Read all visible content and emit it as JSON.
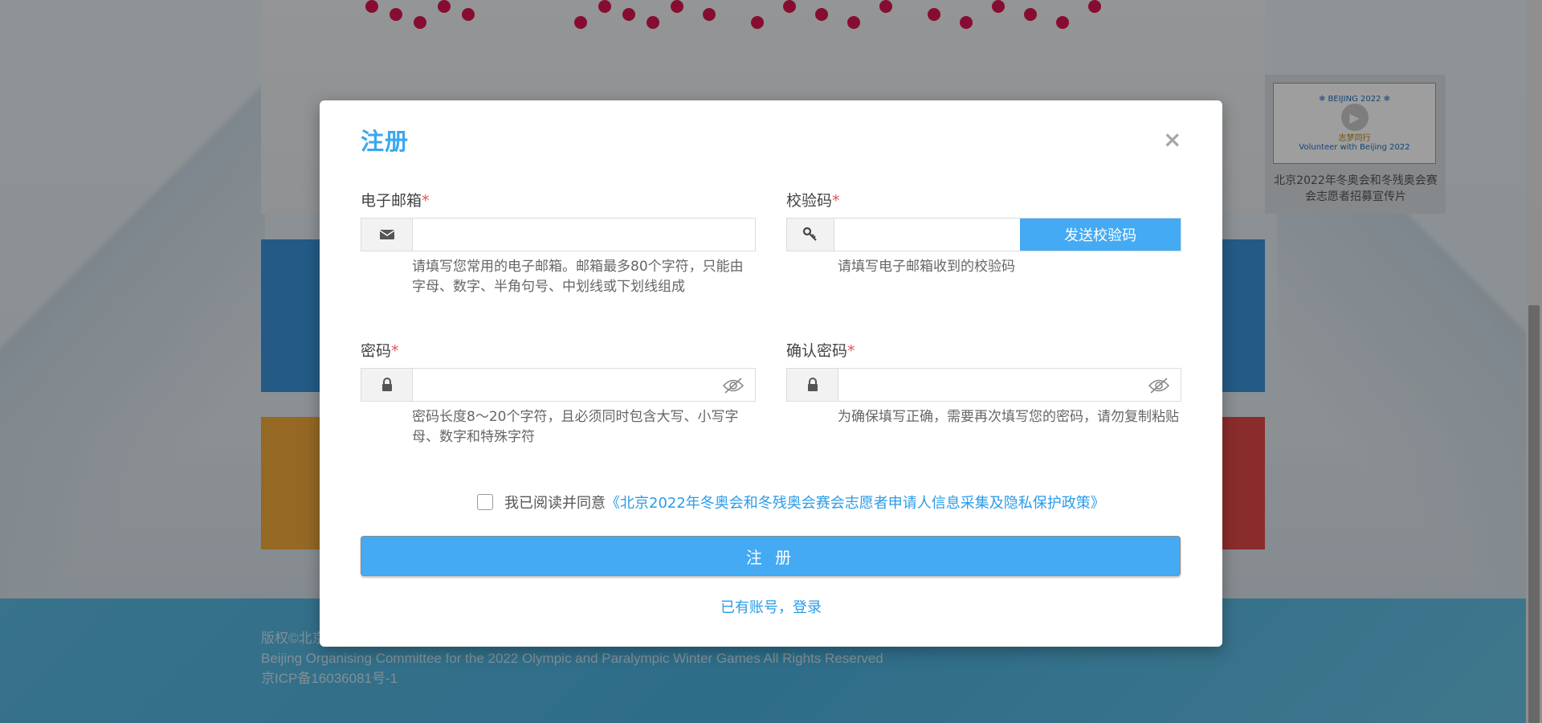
{
  "background": {
    "video_caption": "北京2022年冬奥会和冬残奥会赛会志愿者招募宣传片",
    "video_thumb_caption": "志梦同行",
    "video_thumb_sub": "Volunteer with Beijing 2022",
    "footer": {
      "copyright": "版权©北京",
      "org": "Beijing Organising Committee for the 2022 Olympic and Paralympic Winter Games All Rights Reserved",
      "icp": "京ICP备16036081号-1"
    }
  },
  "modal": {
    "title": "注册",
    "close_icon": "×",
    "email": {
      "label": "电子邮箱",
      "required_mark": "*",
      "value": "",
      "icon": "envelope-icon",
      "help": "请填写您常用的电子邮箱。邮箱最多80个字符，只能由字母、数字、半角句号、中划线或下划线组成"
    },
    "code": {
      "label": "校验码",
      "required_mark": "*",
      "value": "",
      "icon": "key-icon",
      "send_label": "发送校验码",
      "help": "请填写电子邮箱收到的校验码"
    },
    "password": {
      "label": "密码",
      "required_mark": "*",
      "value": "",
      "icon": "lock-icon",
      "help": "密码长度8～20个字符，且必须同时包含大写、小写字母、数字和特殊字符"
    },
    "confirm_password": {
      "label": "确认密码",
      "required_mark": "*",
      "value": "",
      "icon": "lock-icon",
      "help": "为确保填写正确，需要再次填写您的密码，请勿复制粘贴"
    },
    "agree": {
      "text": "我已阅读并同意",
      "policy_link": "《北京2022年冬奥会和冬残奥会赛会志愿者申请人信息采集及隐私保护政策》",
      "checked": false
    },
    "submit_label": "注 册",
    "login_link": "已有账号，登录"
  },
  "colors": {
    "accent": "#44aaf3",
    "title": "#3ba7ee",
    "required": "#e95050"
  }
}
